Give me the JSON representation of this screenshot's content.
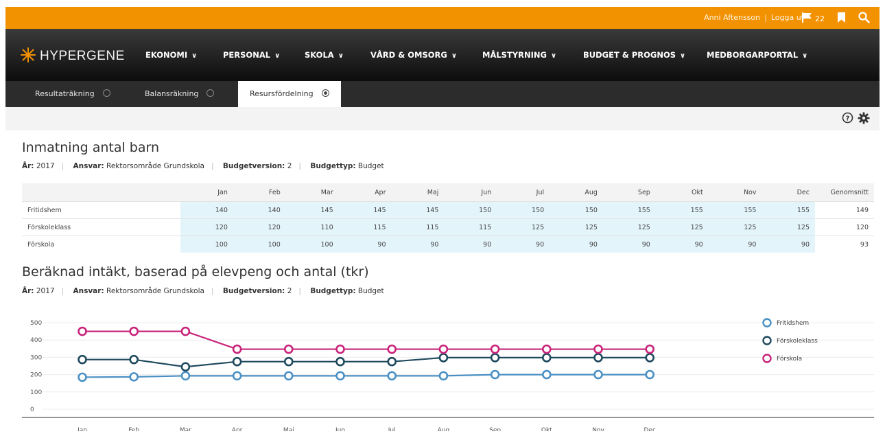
{
  "topbar": {
    "user_name": "Anni Aftensson",
    "logout_label": "Logga ut",
    "flag_count": "22",
    "icons": [
      "flag-icon",
      "bookmark-icon",
      "search-icon"
    ]
  },
  "brand": {
    "name": "HYPERGENE",
    "accent": "#f39200"
  },
  "nav": {
    "items": [
      {
        "label": "EKONOMI"
      },
      {
        "label": "PERSONAL"
      },
      {
        "label": "SKOLA"
      },
      {
        "label": "VÅRD & OMSORG"
      },
      {
        "label": "MÅLSTYRNING"
      },
      {
        "label": "BUDGET & PROGNOS"
      },
      {
        "label": "MEDBORGARPORTAL"
      }
    ]
  },
  "tabs": [
    {
      "label": "Resultaträkning",
      "active": false
    },
    {
      "label": "Balansräkning",
      "active": false
    },
    {
      "label": "Resursfördelning",
      "active": true
    }
  ],
  "section1": {
    "title": "Inmatning antal barn",
    "meta": [
      {
        "key": "År:",
        "value": "2017"
      },
      {
        "key": "Ansvar:",
        "value": "Rektorsområde Grundskola"
      },
      {
        "key": "Budgetversion:",
        "value": "2"
      },
      {
        "key": "Budgettyp:",
        "value": "Budget"
      }
    ],
    "table": {
      "columns": [
        "Jan",
        "Feb",
        "Mar",
        "Apr",
        "Maj",
        "Jun",
        "Jul",
        "Aug",
        "Sep",
        "Okt",
        "Nov",
        "Dec",
        "Genomsnitt"
      ],
      "rows": [
        {
          "label": "Fritidshem",
          "values": [
            "140",
            "140",
            "145",
            "145",
            "145",
            "150",
            "150",
            "150",
            "155",
            "155",
            "155",
            "155",
            "149"
          ]
        },
        {
          "label": "Förskoleklass",
          "values": [
            "120",
            "120",
            "110",
            "115",
            "115",
            "115",
            "125",
            "125",
            "125",
            "125",
            "125",
            "125",
            "120"
          ]
        },
        {
          "label": "Förskola",
          "values": [
            "100",
            "100",
            "100",
            "90",
            "90",
            "90",
            "90",
            "90",
            "90",
            "90",
            "90",
            "90",
            "93"
          ]
        }
      ]
    }
  },
  "section2": {
    "title": "Beräknad intäkt, baserad på elevpeng och antal (tkr)",
    "meta": [
      {
        "key": "År:",
        "value": "2017"
      },
      {
        "key": "Ansvar:",
        "value": "Rektorsområde Grundskola"
      },
      {
        "key": "Budgetversion:",
        "value": "2"
      },
      {
        "key": "Budgettyp:",
        "value": "Budget"
      }
    ]
  },
  "chart_data": {
    "type": "line",
    "categories": [
      "Jan",
      "Feb",
      "Mar",
      "Apr",
      "Maj",
      "Jun",
      "Jul",
      "Aug",
      "Sep",
      "Okt",
      "Nov",
      "Dec"
    ],
    "yticks": [
      "500",
      "400",
      "300",
      "200",
      "100",
      "0"
    ],
    "ylim": [
      0,
      500
    ],
    "grid": true,
    "legend_position": "right",
    "series": [
      {
        "name": "Fritidshem",
        "color": "#4a90c4",
        "values": [
          185,
          187,
          193,
          193,
          193,
          193,
          193,
          193,
          200,
          200,
          200,
          200
        ]
      },
      {
        "name": "Förskoleklass",
        "color": "#1f4a5e",
        "values": [
          287,
          287,
          245,
          275,
          275,
          275,
          275,
          298,
          298,
          298,
          298,
          298
        ]
      },
      {
        "name": "Förskola",
        "color": "#c8247a",
        "values": [
          450,
          450,
          450,
          347,
          347,
          347,
          347,
          347,
          347,
          347,
          347,
          347
        ]
      }
    ]
  },
  "icons": [
    "help-icon",
    "settings-gear-icon",
    "logo-star-icon",
    "chevron-down-icon",
    "tab-close-icon"
  ]
}
